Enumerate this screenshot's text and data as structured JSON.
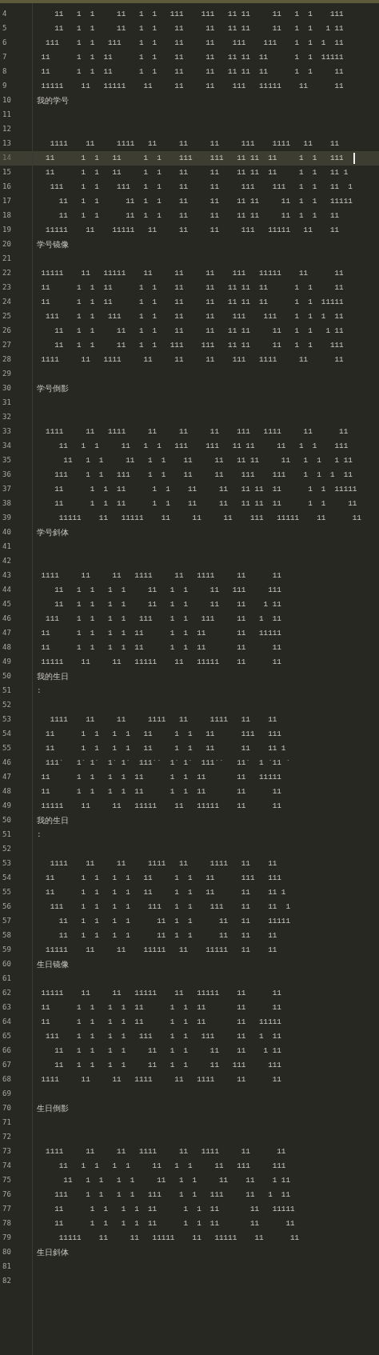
{
  "editor": {
    "lines": [
      {
        "number": "4",
        "text": "    11   1  1     11   1  1   111    111   11 11     11   1  1    111",
        "current": false
      },
      {
        "number": "5",
        "text": "    11   1  1     11   1  1    11     11   11 11     11   1  1   1 11",
        "current": false
      },
      {
        "number": "6",
        "text": "  111    1  1   111    1  1    11     11    111    111    1  1  1  11",
        "current": false
      },
      {
        "number": "7",
        "text": " 11      1  1  11      1  1    11     11   11 11  11      1  1  11111",
        "current": false
      },
      {
        "number": "8",
        "text": " 11      1  1  11      1  1    11     11   11 11  11      1  1     11",
        "current": false
      },
      {
        "number": "9",
        "text": " 11111    11   11111    11     11     11    111   11111    11      11",
        "current": false
      },
      {
        "number": "10",
        "text": "我的学号",
        "current": false
      },
      {
        "number": "11",
        "current": false
      },
      {
        "number": "12",
        "current": false
      },
      {
        "number": "13",
        "text": "   1111    11     1111   11     11     11     111    1111   11    11",
        "current": false
      },
      {
        "number": "14",
        "text": "  11      1  1   11     1  1    111    111   11 11  11     1  1   111",
        "current": true
      },
      {
        "number": "15",
        "text": "  11      1  1   11     1  1    11     11    11 11  11     1  1   11 1",
        "current": false
      },
      {
        "number": "16",
        "text": "   111    1  1    111   1  1    11     11     111    111   1  1   11  1",
        "current": false
      },
      {
        "number": "17",
        "text": "     11   1  1      11  1  1    11     11    11 11     11  1  1   11111",
        "current": false
      },
      {
        "number": "18",
        "text": "     11   1  1      11  1  1    11     11    11 11     11  1  1   11",
        "current": false
      },
      {
        "number": "19",
        "text": "  11111    11    11111   11     11     11     111   11111   11    11",
        "current": false
      },
      {
        "number": "20",
        "text": "学号镜像",
        "current": false
      },
      {
        "number": "21",
        "current": false
      },
      {
        "number": "22",
        "text": " 11111    11   11111    11     11     11    111   11111    11      11",
        "current": false
      },
      {
        "number": "23",
        "text": " 11      1  1  11      1  1    11     11   11 11  11      1  1     11",
        "current": false
      },
      {
        "number": "24",
        "text": " 11      1  1  11      1  1    11     11   11 11  11      1  1  11111",
        "current": false
      },
      {
        "number": "25",
        "text": "  111    1  1   111    1  1    11     11    111    111    1  1  1  11",
        "current": false
      },
      {
        "number": "26",
        "text": "    11   1  1     11   1  1    11     11   11 11     11   1  1   1 11",
        "current": false
      },
      {
        "number": "27",
        "text": "    11   1  1     11   1  1   111    111   11 11     11   1  1    111",
        "current": false
      },
      {
        "number": "28",
        "text": " 1111     11   1111     11     11     11    111   1111     11      11",
        "current": false
      },
      {
        "number": "29",
        "current": false
      },
      {
        "number": "30",
        "text": "学号倒影",
        "current": false
      },
      {
        "number": "31",
        "current": false
      },
      {
        "number": "32",
        "current": false
      },
      {
        "number": "33",
        "text": "  1111     11   1111     11     11     11    111   1111     11      11",
        "current": false
      },
      {
        "number": "34",
        "text": "     11   1  1     11   1  1   111    111   11 11     11   1  1    111",
        "current": false
      },
      {
        "number": "35",
        "text": "      11   1  1     11   1  1    11     11   11 11     11   1  1   1 11",
        "current": false
      },
      {
        "number": "36",
        "text": "    111    1  1   111    1  1    11     11    111    111    1  1  1  11",
        "current": false
      },
      {
        "number": "37",
        "text": "    11      1  1  11      1  1    11     11   11 11  11      1  1  11111",
        "current": false
      },
      {
        "number": "38",
        "text": "    11      1  1  11      1  1    11     11   11 11  11      1  1     11",
        "current": false
      },
      {
        "number": "39",
        "text": "     11111    11   11111    11     11     11    111   11111    11      11",
        "current": false
      },
      {
        "number": "40",
        "text": "学号斜体",
        "current": false
      },
      {
        "number": "41",
        "current": false
      },
      {
        "number": "42",
        "current": false
      },
      {
        "number": "43",
        "text": " 1111     11     11   1111     11   1111     11      11",
        "current": false
      },
      {
        "number": "44",
        "text": "    11   1  1   1  1     11   1  1     11   111     111",
        "current": false
      },
      {
        "number": "45",
        "text": "    11   1  1   1  1     11   1  1     11    11    1 11",
        "current": false
      },
      {
        "number": "46",
        "text": "  111    1  1   1  1   111    1  1   111     11   1  11",
        "current": false
      },
      {
        "number": "47",
        "text": " 11      1  1   1  1  11      1  1  11       11   11111",
        "current": false
      },
      {
        "number": "48",
        "text": " 11      1  1   1  1  11      1  1  11       11      11",
        "current": false
      },
      {
        "number": "49",
        "text": " 11111    11     11   11111    11   11111    11      11",
        "current": false
      },
      {
        "number": "50",
        "text": "我的生日",
        "current": false
      },
      {
        "number": "51",
        "text": ":",
        "current": false
      },
      {
        "number": "52",
        "current": false
      },
      {
        "number": "53",
        "text": "   1111    11     11     1111   11     1111   11    11",
        "current": false
      },
      {
        "number": "54",
        "text": "  11      1  1   1  1   11     1  1   11      111   111",
        "current": false
      },
      {
        "number": "55",
        "text": "  11      1  1   1  1   11     1  1   11      11    11 1",
        "current": false
      },
      {
        "number": "46",
        "text": "  111`   1` 1`  1` 1`  111``  1` 1`  111``   11`  1 `11 `",
        "current": false
      },
      {
        "number": "47",
        "text": " 11      1  1   1  1  11      1  1  11       11   11111",
        "current": false
      },
      {
        "number": "48",
        "text": " 11      1  1   1  1  11      1  1  11       11      11",
        "current": false
      },
      {
        "number": "49",
        "text": " 11111    11     11   11111    11   11111    11      11",
        "current": false
      },
      {
        "number": "50",
        "text": "我的生日",
        "current": false
      },
      {
        "number": "51",
        "text": ":",
        "current": false
      },
      {
        "number": "52",
        "current": false
      },
      {
        "number": "53",
        "text": "   1111    11     11     1111   11     1111   11    11",
        "current": false
      },
      {
        "number": "54",
        "text": "  11      1  1   1  1   11     1  1   11      111   111",
        "current": false
      },
      {
        "number": "55",
        "text": "  11      1  1   1  1   11     1  1   11      11    11 1",
        "current": false
      },
      {
        "number": "56",
        "text": "   111    1  1   1  1    111   1  1    111    11    11  1",
        "current": false
      },
      {
        "number": "57",
        "text": "     11   1  1   1  1      11  1  1      11   11    11111",
        "current": false
      },
      {
        "number": "58",
        "text": "     11   1  1   1  1      11  1  1      11   11    11",
        "current": false
      },
      {
        "number": "59",
        "text": "  11111    11     11    11111   11    11111   11    11",
        "current": false
      },
      {
        "number": "60",
        "text": "生日镜像",
        "current": false
      },
      {
        "number": "61",
        "current": false
      },
      {
        "number": "62",
        "text": " 11111    11     11   11111    11   11111    11      11",
        "current": false
      },
      {
        "number": "63",
        "text": " 11      1  1   1  1  11      1  1  11       11      11",
        "current": false
      },
      {
        "number": "64",
        "text": " 11      1  1   1  1  11      1  1  11       11   11111",
        "current": false
      },
      {
        "number": "65",
        "text": "  111    1  1   1  1   111    1  1   111     11   1  11",
        "current": false
      },
      {
        "number": "66",
        "text": "    11   1  1   1  1     11   1  1     11    11    1 11",
        "current": false
      },
      {
        "number": "67",
        "text": "    11   1  1   1  1     11   1  1     11   111     111",
        "current": false
      },
      {
        "number": "68",
        "text": " 1111     11     11   1111     11   1111     11      11",
        "current": false
      },
      {
        "number": "69",
        "current": false
      },
      {
        "number": "70",
        "text": "生日倒影",
        "current": false
      },
      {
        "number": "71",
        "current": false
      },
      {
        "number": "72",
        "current": false
      },
      {
        "number": "73",
        "text": "  1111     11     11   1111     11   1111     11      11",
        "current": false
      },
      {
        "number": "74",
        "text": "     11   1  1   1  1     11   1  1     11   111     111",
        "current": false
      },
      {
        "number": "75",
        "text": "      11   1  1   1  1     11   1  1     11    11    1 11",
        "current": false
      },
      {
        "number": "76",
        "text": "    111    1  1   1  1   111    1  1   111     11   1  11",
        "current": false
      },
      {
        "number": "77",
        "text": "    11      1  1   1  1  11      1  1  11       11   11111",
        "current": false
      },
      {
        "number": "78",
        "text": "    11      1  1   1  1  11      1  1  11       11      11",
        "current": false
      },
      {
        "number": "79",
        "text": "     11111    11     11   11111    11   11111    11      11",
        "current": false
      },
      {
        "number": "80",
        "text": "生日斜体",
        "current": false
      },
      {
        "number": "81",
        "current": false
      },
      {
        "number": "82",
        "current": false
      }
    ]
  }
}
